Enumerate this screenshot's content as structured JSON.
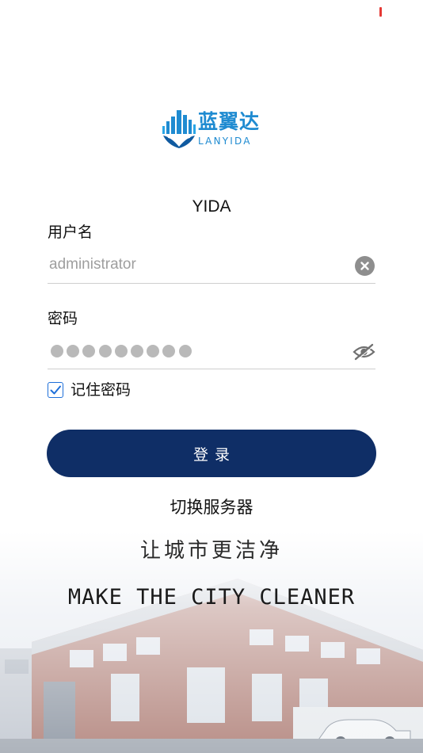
{
  "logo": {
    "title": "蓝翼达",
    "subtitle": "LANYIDA"
  },
  "app_name": "YIDA",
  "username": {
    "label": "用户名",
    "placeholder": "administrator",
    "value": ""
  },
  "password": {
    "label": "密码",
    "masked_length": 9
  },
  "remember": {
    "label": "记住密码",
    "checked": true
  },
  "login_button": {
    "label": "登录"
  },
  "switch_server": {
    "label": "切换服务器"
  },
  "slogan": {
    "cn": "让城市更洁净",
    "en": "MAKE THE CITY CLEANER"
  },
  "colors": {
    "primary": "#0f2e66",
    "brand": "#1f8bd1",
    "checkbox": "#1e6fd9"
  }
}
